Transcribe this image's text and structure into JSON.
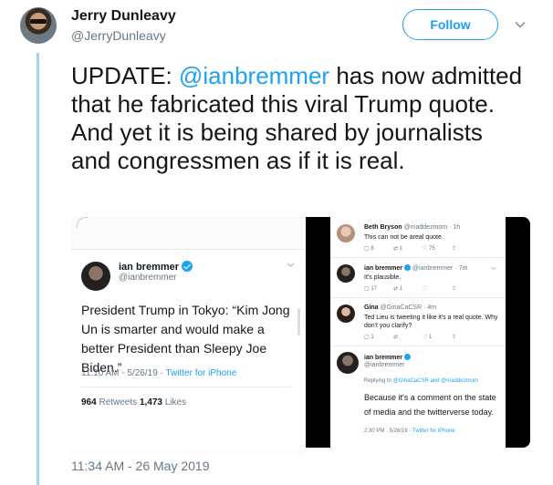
{
  "author": {
    "name": "Jerry Dunleavy",
    "handle": "@JerryDunleavy"
  },
  "follow_label": "Follow",
  "tweet": {
    "text_prefix": "UPDATE: ",
    "mention": "@ianbremmer",
    "text_suffix": " has now admitted that he fabricated this viral Trump quote. And yet it is being shared by journalists and congressmen as if it is real.",
    "timestamp": "11:34 AM - 26 May 2019"
  },
  "image1": {
    "name": "ian bremmer",
    "handle": "@ianbremmer",
    "text": "President Trump in Tokyo: “Kim Jong Un is smarter and would make a better President than Sleepy Joe Biden.”",
    "time": "11:10 AM - 5/26/19 · ",
    "via": "Twitter for iPhone",
    "retweets_count": "964",
    "retweets_label": " Retweets ",
    "likes_count": "1,473",
    "likes_label": " Likes"
  },
  "image2": {
    "replies": [
      {
        "name": "Beth Bryson",
        "meta": " @maddezmom · 1h",
        "text": "This can not be areal quote.",
        "actions": [
          "8",
          "1",
          "75",
          ""
        ]
      },
      {
        "name": "ian bremmer",
        "meta": " @ianbremmer · 7m",
        "text": "It's plausible.",
        "actions": [
          "17",
          "1",
          "",
          ""
        ]
      },
      {
        "name": "Gina",
        "meta": " @GinaCaCSR · 4m",
        "text": "Ted Lieu is tweeting it like it's a real quote. Why don't you clarify?",
        "actions": [
          "1",
          "",
          "1",
          ""
        ]
      }
    ],
    "main_name": "ian bremmer",
    "main_handle": "@ianbremmer",
    "replying_prefix": "Replying to ",
    "replying_to": "@GinaCaCSR and @maddezmom",
    "main_text": "Because it's a comment on the state of media and the twitterverse today.",
    "time": "2:30 PM · 5/26/19 · ",
    "via": "Twitter for iPhone"
  },
  "colors": {
    "accent": "#1da1f2",
    "thread_line": "#9ad8ee",
    "muted": "#657786"
  },
  "icons": [
    "chevron-down-icon",
    "verified-icon",
    "reply-icon",
    "retweet-icon",
    "like-icon",
    "share-icon"
  ]
}
